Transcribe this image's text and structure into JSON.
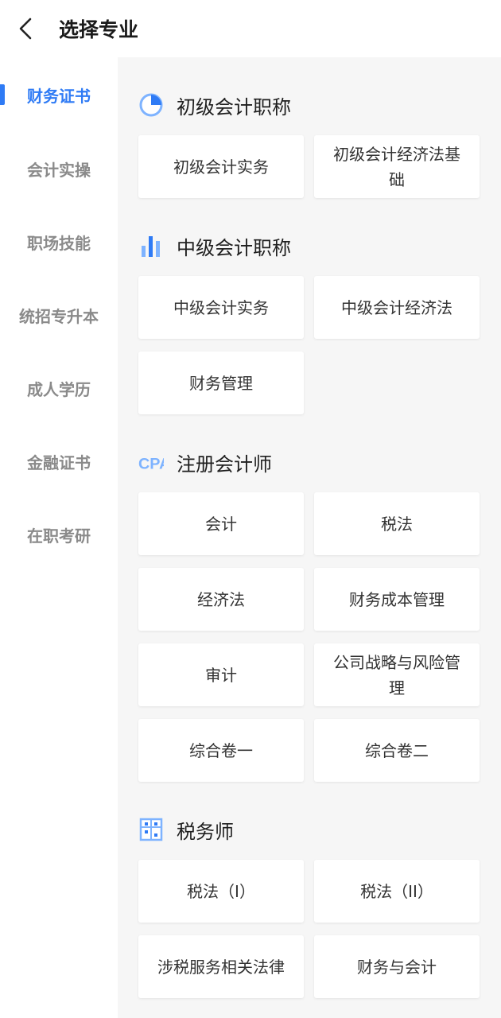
{
  "header": {
    "title": "选择专业"
  },
  "sidebar": {
    "items": [
      {
        "label": "财务证书",
        "active": true
      },
      {
        "label": "会计实操"
      },
      {
        "label": "职场技能"
      },
      {
        "label": "统招专升本"
      },
      {
        "label": "成人学历"
      },
      {
        "label": "金融证书"
      },
      {
        "label": "在职考研"
      }
    ]
  },
  "sections": [
    {
      "title": "初级会计职称",
      "icon": "pie-chart-icon",
      "items": [
        "初级会计实务",
        "初级会计经济法基础"
      ]
    },
    {
      "title": "中级会计职称",
      "icon": "bar-chart-icon",
      "items": [
        "中级会计实务",
        "中级会计经济法",
        "财务管理"
      ]
    },
    {
      "title": "注册会计师",
      "icon": "cpa-icon",
      "icon_text": "CPA",
      "items": [
        "会计",
        "税法",
        "经济法",
        "财务成本管理",
        "审计",
        "公司战略与风险管理",
        "综合卷一",
        "综合卷二"
      ]
    },
    {
      "title": "税务师",
      "icon": "abacus-icon",
      "items": [
        "税法（I）",
        "税法（II）",
        "涉税服务相关法律",
        "财务与会计"
      ]
    }
  ],
  "colors": {
    "accent": "#2f7bf5",
    "accent_light": "#7eb3ff"
  }
}
